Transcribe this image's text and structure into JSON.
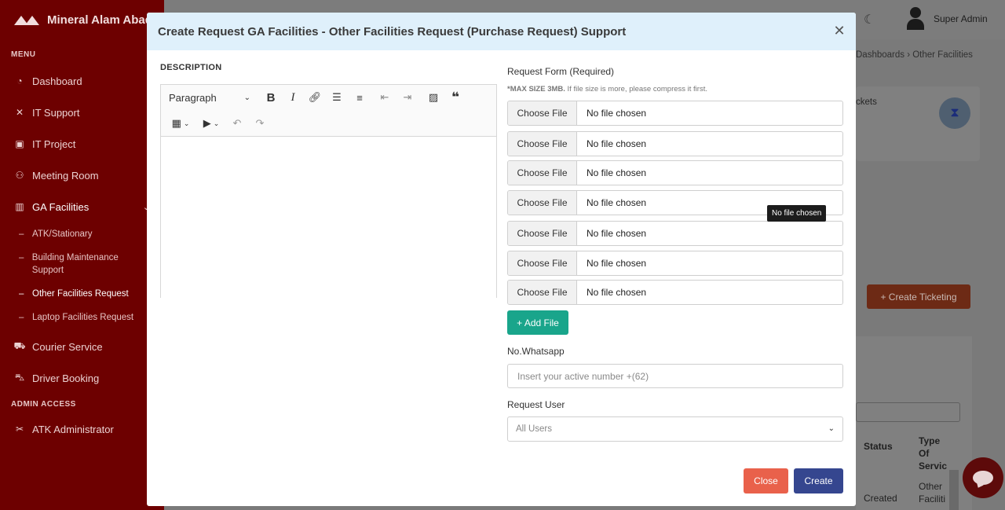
{
  "sidebar": {
    "brand": "Mineral Alam Abadi",
    "menu_title": "MENU",
    "items": [
      {
        "label": "Dashboard",
        "icon": "dashboard-icon"
      },
      {
        "label": "IT Support",
        "icon": "tools-icon"
      },
      {
        "label": "IT Project",
        "icon": "project-icon"
      },
      {
        "label": "Meeting Room",
        "icon": "meeting-room-icon"
      },
      {
        "label": "GA Facilities",
        "icon": "building-icon"
      }
    ],
    "sub_items": [
      "ATK/Stationary",
      "Building Maintenance Support",
      "Other Facilities Request",
      "Laptop Facilities Request"
    ],
    "items2": [
      {
        "label": "Courier Service",
        "icon": "truck-icon"
      },
      {
        "label": "Driver Booking",
        "icon": "car-icon"
      }
    ],
    "admin_title": "ADMIN ACCESS",
    "admin_items": [
      {
        "label": "ATK Administrator",
        "icon": "scissors-icon"
      }
    ]
  },
  "header": {
    "username": "Super Admin",
    "breadcrumb": "Dashboards  ›  Other Facilities"
  },
  "background": {
    "card_text": "ckets",
    "create_ticketing": "+  Create Ticketing",
    "th_status": "Status",
    "th_type": "Type Of Servic",
    "td_status": "Created",
    "td_type": "Other Faciliti"
  },
  "modal": {
    "title": "Create Request GA Facilities - Other Facilities Request (Purchase Request) Support",
    "description_label": "DESCRIPTION",
    "editor": {
      "paragraph": "Paragraph"
    },
    "request_form_label": "Request Form (Required)",
    "max_size_bold": "*MAX SIZE 3MB.",
    "max_size_note": " If file size is more, please compress it first.",
    "file_button": "Choose File",
    "file_status": "No file chosen",
    "file_count": 7,
    "tooltip": "No file chosen",
    "add_file": "+ Add File",
    "whatsapp_label": "No.Whatsapp",
    "whatsapp_placeholder": "Insert your active number +(62)",
    "request_user_label": "Request User",
    "request_user_value": "All Users",
    "close_button": "Close",
    "create_button": "Create"
  },
  "colors": {
    "sidebar_bg": "#6d0000",
    "modal_header_bg": "#dff0fb",
    "add_file": "#19a58b",
    "close_button": "#e9614b",
    "create_button": "#35468f"
  }
}
